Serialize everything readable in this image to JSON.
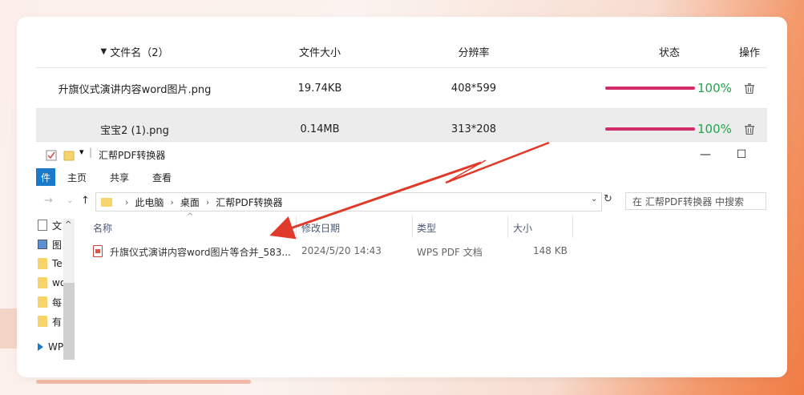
{
  "converter": {
    "headers": {
      "name": "文件名（2）",
      "size": "文件大小",
      "resolution": "分辨率",
      "status": "状态",
      "action": "操作"
    },
    "rows": [
      {
        "name": "升旗仪式演讲内容word图片.png",
        "size": "19.74KB",
        "resolution": "408*599",
        "progress": "100%",
        "progress_fraction": 1.0,
        "selected": false
      },
      {
        "name": "宝宝2 (1).png",
        "size": "0.14MB",
        "resolution": "313*208",
        "progress": "100%",
        "progress_fraction": 1.0,
        "selected": true
      }
    ],
    "colors": {
      "progress_bar": "#d32c6a",
      "progress_text": "#1fa64a"
    },
    "delete_icon": "trash-icon"
  },
  "explorer": {
    "title": "汇帮PDF转换器",
    "ribbon": {
      "file_tab": "件",
      "tabs": [
        "主页",
        "共享",
        "查看"
      ]
    },
    "address": {
      "crumbs": [
        "此电脑",
        "桌面",
        "汇帮PDF转换器"
      ]
    },
    "search_placeholder": "在 汇帮PDF转换器 中搜索",
    "nav_items": [
      "文",
      "图",
      "Te",
      "wo",
      "每",
      "有",
      "WP"
    ],
    "columns": [
      "名称",
      "修改日期",
      "类型",
      "大小"
    ],
    "files": [
      {
        "name": "升旗仪式演讲内容word图片等合并_583...",
        "modified": "2024/5/20 14:43",
        "type": "WPS PDF 文档",
        "size": "148 KB"
      }
    ],
    "accent": "#1979ca"
  }
}
